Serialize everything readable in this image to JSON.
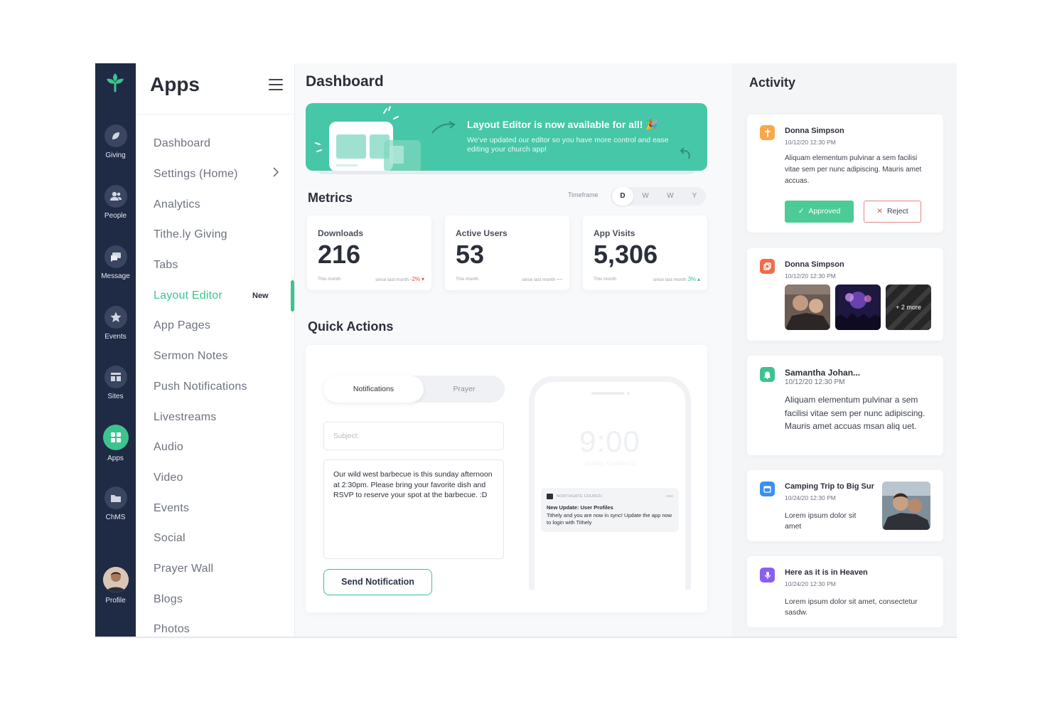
{
  "rail": {
    "items": [
      {
        "label": "Giving",
        "icon": "leaf-icon"
      },
      {
        "label": "People",
        "icon": "people-icon"
      },
      {
        "label": "Message",
        "icon": "message-icon"
      },
      {
        "label": "Events",
        "icon": "star-icon"
      },
      {
        "label": "Sites",
        "icon": "sites-icon"
      },
      {
        "label": "Apps",
        "icon": "apps-grid-icon",
        "active": true
      },
      {
        "label": "ChMS",
        "icon": "folder-icon"
      },
      {
        "label": "Profile",
        "icon": "avatar"
      }
    ]
  },
  "apps_menu": {
    "title": "Apps",
    "items": [
      {
        "label": "Dashboard"
      },
      {
        "label": "Settings (Home)",
        "has_chevron": true
      },
      {
        "label": "Analytics"
      },
      {
        "label": "Tithe.ly Giving"
      },
      {
        "label": "Tabs"
      },
      {
        "label": "Layout Editor",
        "active": true,
        "badge": "New"
      },
      {
        "label": "App Pages"
      },
      {
        "label": "Sermon Notes"
      },
      {
        "label": "Push Notifications"
      },
      {
        "label": "Livestreams"
      },
      {
        "label": "Audio"
      },
      {
        "label": "Video"
      },
      {
        "label": "Events"
      },
      {
        "label": "Social"
      },
      {
        "label": "Prayer Wall"
      },
      {
        "label": "Blogs"
      },
      {
        "label": "Photos"
      }
    ]
  },
  "main": {
    "title": "Dashboard",
    "banner": {
      "title": "Layout Editor is now available for all! 🎉",
      "text": "We've updated our editor so you have more control and ease editing your church app!"
    },
    "metrics": {
      "title": "Metrics",
      "timeframe_label": "Timeframe",
      "timeframe_options": [
        "D",
        "W",
        "W",
        "Y"
      ],
      "selected": "D",
      "cards": [
        {
          "label": "Downloads",
          "value": "216",
          "period": "This month",
          "compare": "since last month",
          "trend": "-2%",
          "direction": "down"
        },
        {
          "label": "Active Users",
          "value": "53",
          "period": "This month",
          "compare": "since last month",
          "trend": "—",
          "direction": "flat"
        },
        {
          "label": "App Visits",
          "value": "5,306",
          "period": "This month",
          "compare": "since last month",
          "trend": "3%",
          "direction": "up"
        }
      ]
    },
    "quick_actions": {
      "title": "Quick Actions",
      "tabs": [
        "Notifications",
        "Prayer"
      ],
      "subject_placeholder": "Subject:",
      "body": "Our wild west barbecue is this sunday afternoon at 2:30pm. Please bring your favorite dish and RSVP to reserve your spot at the barbecue. :D",
      "send_label": "Send Notification",
      "preview": {
        "time": "9:00",
        "date": "Sunday, October 12",
        "app_name": "NORTHGATE CHURCH",
        "when": "now",
        "title": "New Update: User Profiles",
        "text": "Tithely and you are now in sync! Update the app now to login with Tithely"
      }
    }
  },
  "activity": {
    "title": "Activity",
    "items": [
      {
        "name": "Donna Simpson",
        "time": "10/12/20 12:30 PM",
        "text": "Aliquam elementum pulvinar a sem facilisi vitae sem per nunc adipiscing. Mauris amet accuas.",
        "approve_label": "Approved",
        "reject_label": "Reject",
        "icon": "prayer-icon",
        "color": "#f6a84a"
      },
      {
        "name": "Donna Simpson",
        "time": "10/12/20 12:30 PM",
        "more_label": "+ 2 more",
        "icon": "photos-icon",
        "color": "#f26b4a"
      },
      {
        "name": "Samantha Johan...",
        "time": "10/12/20 12:30 PM",
        "text": "Aliquam elementum pulvinar a sem facilisi vitae sem per nunc adipiscing. Mauris amet accuas msan aliq uet.",
        "icon": "bell-icon",
        "color": "#3cc48f"
      },
      {
        "name": "Camping Trip to Big Sur",
        "time": "10/24/20 12:30 PM",
        "text": "Lorem ipsum dolor sit amet",
        "icon": "calendar-icon",
        "color": "#3b8ff0"
      },
      {
        "name": "Here as it is in Heaven",
        "time": "10/24/20 12:30 PM",
        "text": "Lorem ipsum dolor sit amet, consectetur sasdw.",
        "icon": "microphone-icon",
        "color": "#8c5ef0"
      }
    ]
  },
  "colors": {
    "accent": "#3cc48f",
    "rail": "#1f2a44",
    "banner": "#46c7a7",
    "negative": "#e0524f"
  }
}
